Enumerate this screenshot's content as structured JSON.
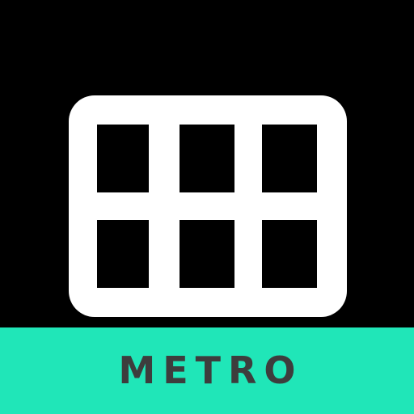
{
  "app": {
    "label": "METRO",
    "icon": "grid-icon"
  },
  "colors": {
    "background": "#000000",
    "icon_stroke": "#ffffff",
    "label_bar": "#20e6b8",
    "label_text": "#3d3d3d"
  }
}
